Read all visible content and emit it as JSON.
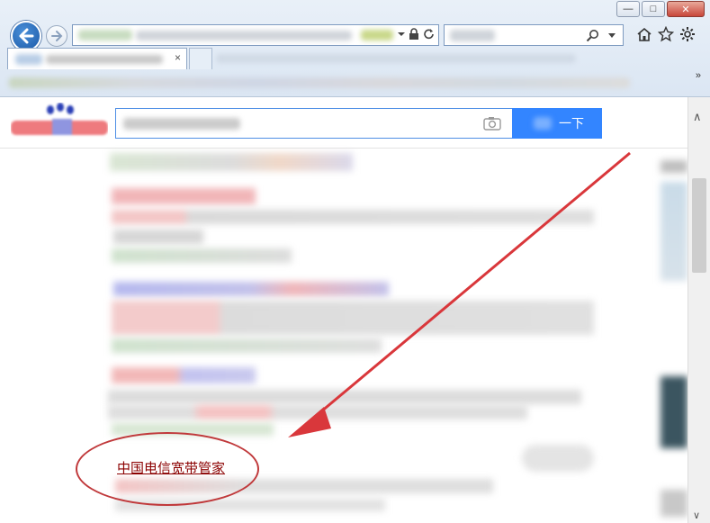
{
  "toolbar": {
    "minimize_glyph": "—",
    "maximize_glyph": "□",
    "close_glyph": "✕"
  },
  "tab": {
    "close_glyph": "×"
  },
  "favorites": {
    "more_glyph": "»"
  },
  "search": {
    "button_label": "一下"
  },
  "results": {
    "highlighted_link": "中国电信宽带管家"
  },
  "scrollbar": {
    "up_glyph": "∧",
    "down_glyph": "∨"
  },
  "colors": {
    "accent": "#3385ff",
    "annotation": "#d9373b",
    "link": "#8b0000"
  }
}
